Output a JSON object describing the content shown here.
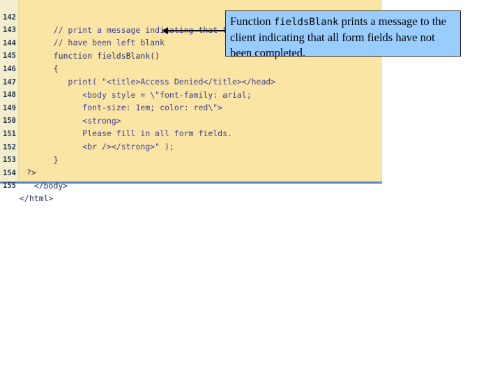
{
  "code": {
    "lines": [
      {
        "num": "142",
        "text": "   // print a message indicating that fields"
      },
      {
        "num": "143",
        "text": "   // have been left blank"
      },
      {
        "num": "144",
        "text": "   function fieldsBlank()"
      },
      {
        "num": "145",
        "text": "   {"
      },
      {
        "num": "146",
        "text": "      print( \"<title>Access Denied</title></head>"
      },
      {
        "num": "147",
        "text": "         <body style = \\\"font-family: arial;"
      },
      {
        "num": "148",
        "text": "         font-size: 1em; color: red\\\">"
      },
      {
        "num": "149",
        "text": "         <strong>"
      },
      {
        "num": "150",
        "text": "         Please fill in all form fields."
      },
      {
        "num": "151",
        "text": "         <br /></strong>\" );"
      },
      {
        "num": "152",
        "text": "   }"
      },
      {
        "num": "153",
        "text": "?>"
      },
      {
        "num": "154",
        "text": "   </body>"
      },
      {
        "num": "155",
        "text": "</html>"
      }
    ]
  },
  "callout": {
    "text_before": "Function ",
    "code_word": "fieldsBlank",
    "text_after": " prints a message to the client indicating that all form fields have not been completed."
  }
}
